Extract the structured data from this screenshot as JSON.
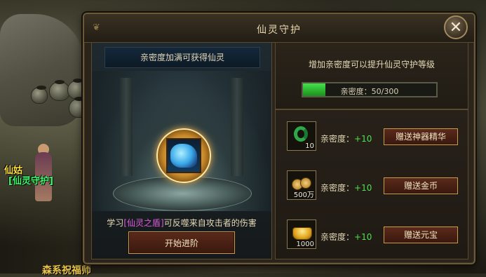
{
  "dialog": {
    "title": "仙灵守护",
    "close_label": "✕"
  },
  "scene": {
    "npc_name": "仙姑",
    "npc_title": "[仙灵守护]",
    "npc2_name": "森系祝福师",
    "edge_tag": "["
  },
  "left_panel": {
    "header": "亲密度加满可获得仙灵",
    "desc_prefix": "学习",
    "desc_skill": "[仙灵之盾]",
    "desc_suffix": "可反噬来自攻击者的伤害",
    "advance_label": "开始进阶",
    "spirit_icon": "spirit-beast-icon"
  },
  "right_top": {
    "text": "增加亲密度可以提升仙灵守护等级",
    "bar_label": "亲密度：50/300",
    "affinity_current": 50,
    "affinity_max": 300,
    "bar_color": "#3cc840"
  },
  "gifts": [
    {
      "icon": "jade-ring-icon",
      "qty": "10",
      "affinity_label": "亲密度：",
      "affinity_plus": "+10",
      "button": "赠送神器精华"
    },
    {
      "icon": "gold-coins-icon",
      "qty": "500万",
      "affinity_label": "亲密度：",
      "affinity_plus": "+10",
      "button": "赠送金币"
    },
    {
      "icon": "gold-ingot-icon",
      "qty": "1000",
      "affinity_label": "亲密度：",
      "affinity_plus": "+10",
      "button": "赠送元宝"
    }
  ]
}
